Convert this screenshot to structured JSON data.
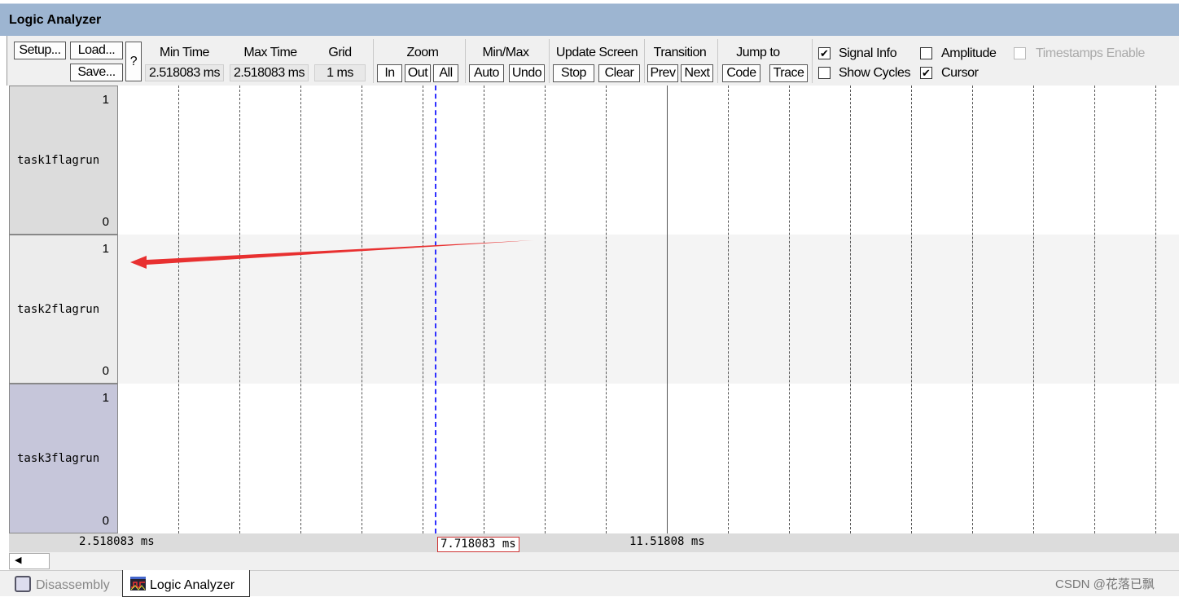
{
  "window": {
    "title": "Logic Analyzer"
  },
  "toolbar": {
    "setup": "Setup...",
    "load": "Load...",
    "save": "Save...",
    "help": "?",
    "min_time_label": "Min Time",
    "min_time": "2.518083 ms",
    "max_time_label": "Max Time",
    "max_time": "2.518083 ms",
    "grid_label": "Grid",
    "grid": "1 ms",
    "zoom_label": "Zoom",
    "zoom_in": "In",
    "zoom_out": "Out",
    "zoom_all": "All",
    "minmax_label": "Min/Max",
    "auto": "Auto",
    "undo": "Undo",
    "update_label": "Update Screen",
    "stop": "Stop",
    "clear": "Clear",
    "transition_label": "Transition",
    "prev": "Prev",
    "next": "Next",
    "jump_label": "Jump to",
    "code": "Code",
    "trace": "Trace",
    "options": [
      {
        "label": "Signal Info",
        "checked": true,
        "enabled": true
      },
      {
        "label": "Show Cycles",
        "checked": false,
        "enabled": true
      },
      {
        "label": "Amplitude",
        "checked": false,
        "enabled": true
      },
      {
        "label": "Cursor",
        "checked": true,
        "enabled": true
      },
      {
        "label": "Timestamps Enable",
        "checked": false,
        "enabled": false
      }
    ]
  },
  "signals": [
    {
      "name": "task1flagrun",
      "high": "1",
      "low": "0",
      "color": "#dcdcdc"
    },
    {
      "name": "task2flagrun",
      "high": "1",
      "low": "0",
      "color": "#ececec"
    },
    {
      "name": "task3flagrun",
      "high": "1",
      "low": "0",
      "color": "#c6c6da"
    }
  ],
  "axis": {
    "start": "2.518083 ms",
    "cursor": "7.718083 ms",
    "end": "11.51808 ms"
  },
  "tabs": [
    {
      "label": "Disassembly",
      "active": false
    },
    {
      "label": "Logic Analyzer",
      "active": true
    }
  ],
  "watermark": "CSDN @花落已飘",
  "colors": {
    "cursor": "#3030ff",
    "annotation_arrow": "#e83030",
    "titlebar": "#9db5d1"
  }
}
